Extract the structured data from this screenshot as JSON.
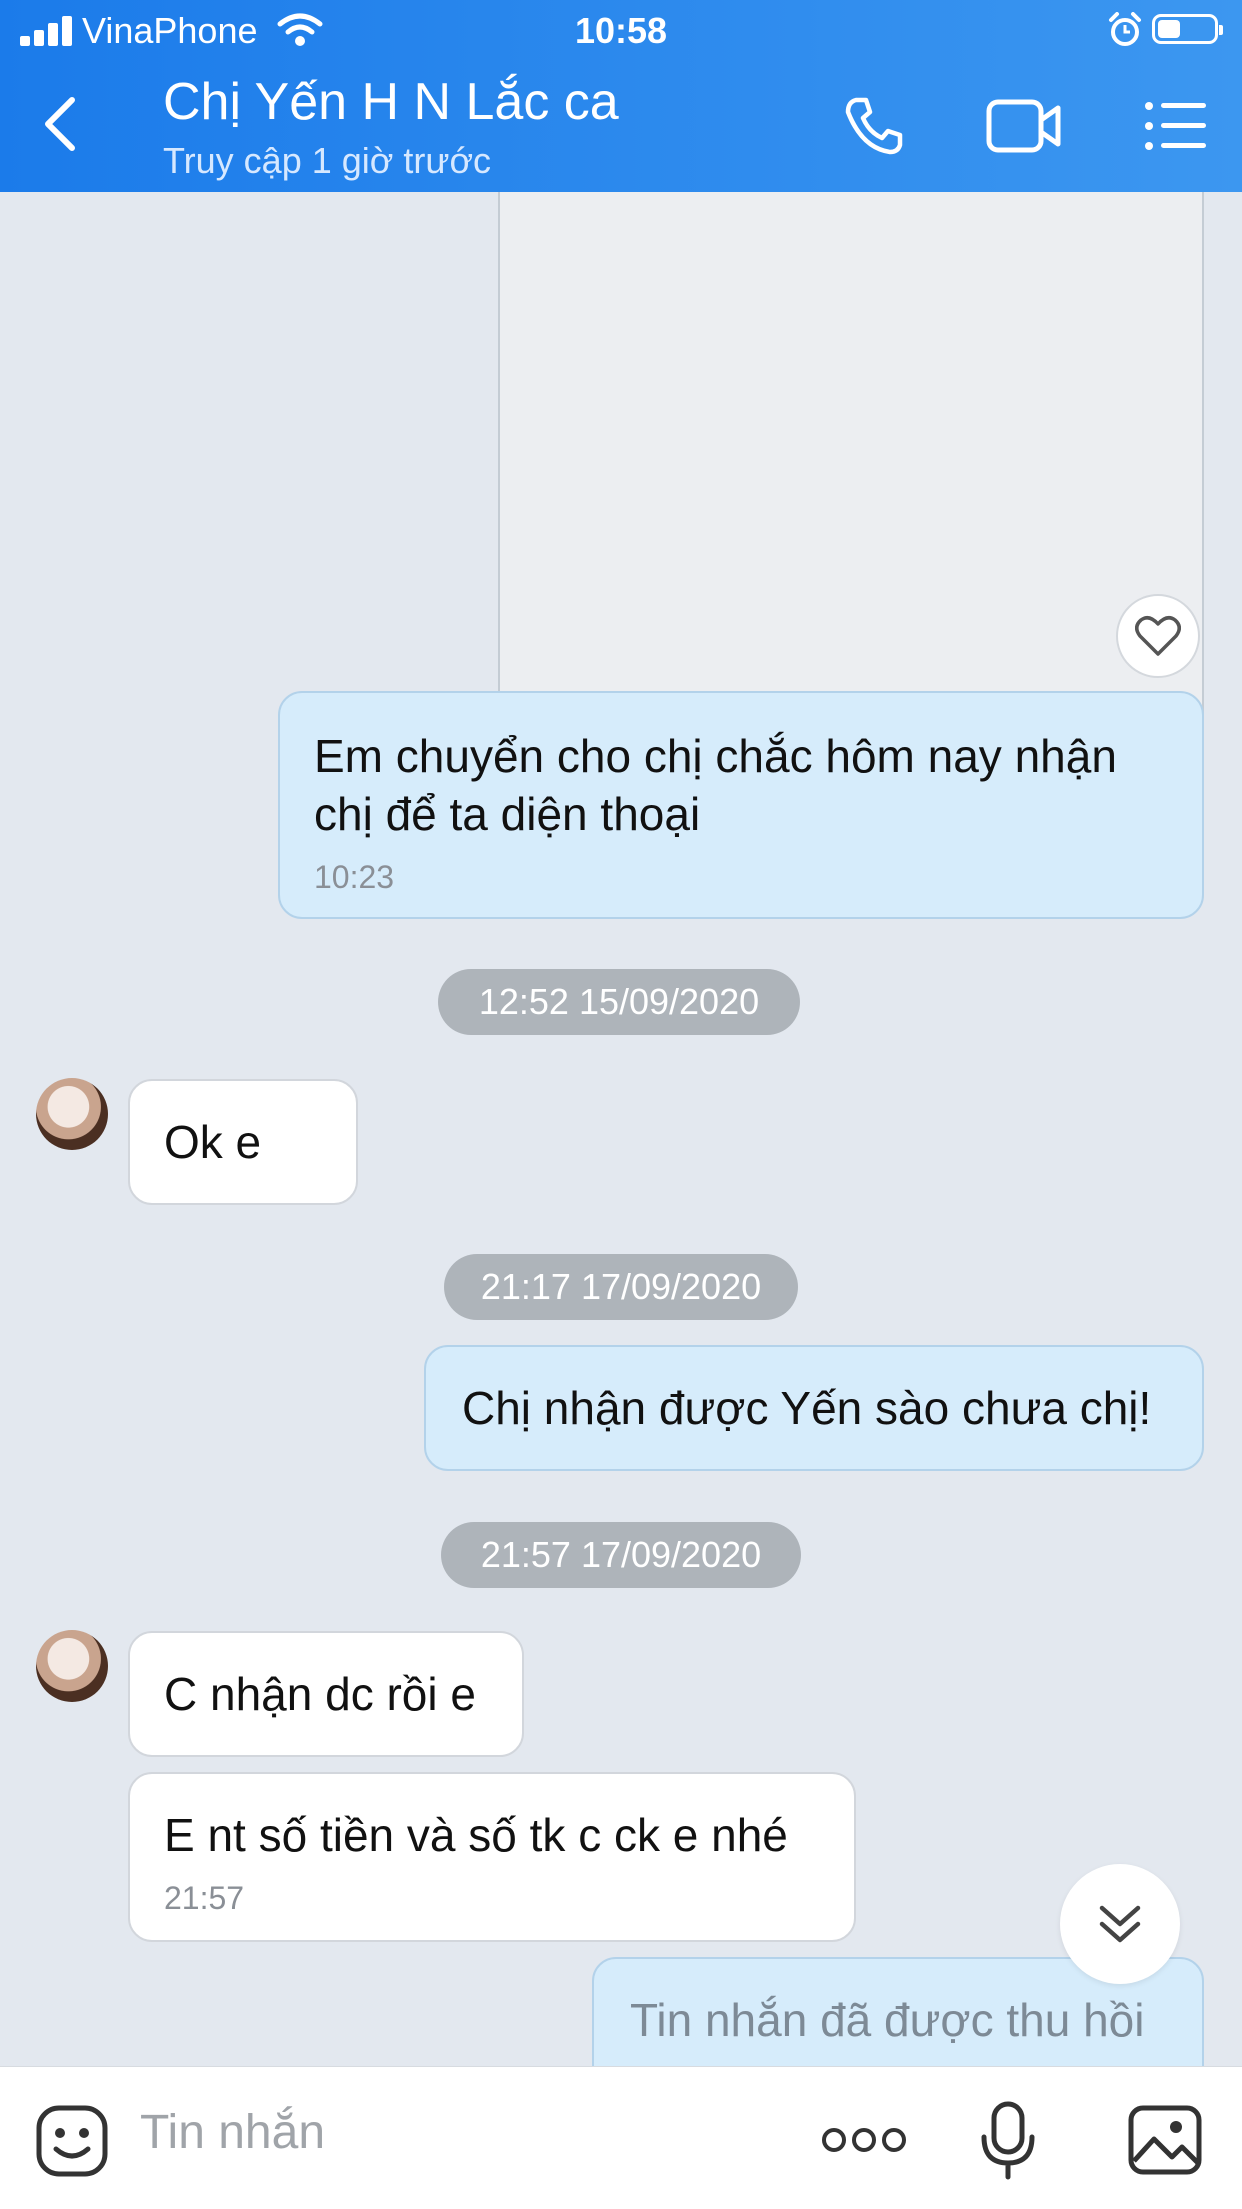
{
  "status_bar": {
    "carrier": "VinaPhone",
    "time": "10:58"
  },
  "header": {
    "title": "Chị Yến H N Lắc ca",
    "subtitle": "Truy cập 1 giờ trước"
  },
  "messages": [
    {
      "side": "sent",
      "text": "Em chuyển cho chị chắc hôm nay nhận chị để ta diện thoại",
      "time": "10:23"
    },
    {
      "date": "12:52 15/09/2020"
    },
    {
      "side": "received",
      "text": "Ok e"
    },
    {
      "date": "21:17 17/09/2020"
    },
    {
      "side": "sent",
      "text": "Chị nhận được Yến sào chưa chị!"
    },
    {
      "date": "21:57 17/09/2020"
    },
    {
      "side": "received",
      "text": "C nhận dc rồi e"
    },
    {
      "side": "received",
      "text": "E nt số tiền và số tk c ck e nhé",
      "time": "21:57"
    },
    {
      "side": "sent",
      "text": "Tin nhắn đã được thu hồi"
    }
  ],
  "input": {
    "placeholder": "Tin nhắn"
  },
  "icons": [
    "back-icon",
    "phone-icon",
    "video-icon",
    "menu-icon",
    "heart-icon",
    "scroll-down-icon",
    "sticker-icon",
    "more-icon",
    "mic-icon",
    "image-icon"
  ],
  "colors": {
    "header": "#2a88ed",
    "sent_bubble": "#d6ecfb",
    "received_bubble": "#ffffff",
    "chat_bg": "#e3e8ef"
  }
}
